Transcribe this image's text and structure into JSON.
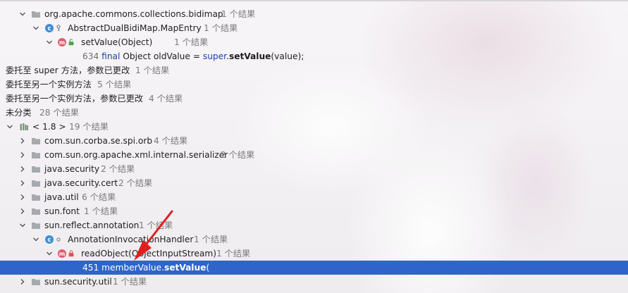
{
  "tree": {
    "pkg_bidimap": {
      "label": "org.apache.commons.collections.bidimap",
      "count": "1 个结果"
    },
    "class_mapentry": {
      "label": "AbstractDualBidiMap.MapEntry",
      "count": "1 个结果"
    },
    "method_setvalue": {
      "label": "setValue(Object)",
      "count": "1 个结果"
    },
    "code_634": {
      "line": "634",
      "kw_final": "final",
      "mid": " Object oldValue = ",
      "kw_super": "super",
      "dot": ".",
      "method": "setValue",
      "tail": "(value);"
    },
    "group_super": {
      "label": "委托至 super 方法，参数已更改",
      "count": "1 个结果"
    },
    "group_other": {
      "label": "委托至另一个实例方法",
      "count": "5 个结果"
    },
    "group_other_changed": {
      "label": "委托至另一个实例方法，参数已更改",
      "count": "4 个结果"
    },
    "group_unclassified": {
      "label": "未分类",
      "count": "28 个结果"
    },
    "lib_jdk": {
      "label": "< 1.8 >",
      "count": "19 个结果"
    },
    "pkgs": [
      {
        "label": "com.sun.corba.se.spi.orb",
        "count": "4 个结果"
      },
      {
        "label": "com.sun.org.apache.xml.internal.serializer",
        "count": "2 个结果"
      },
      {
        "label": "java.security",
        "count": "2 个结果"
      },
      {
        "label": "java.security.cert",
        "count": "2 个结果"
      },
      {
        "label": "java.util",
        "count": "6 个结果"
      },
      {
        "label": "sun.font",
        "count": "1 个结果"
      }
    ],
    "pkg_reflect": {
      "label": "sun.reflect.annotation",
      "count": "1 个结果"
    },
    "class_aih": {
      "label": "AnnotationInvocationHandler",
      "count": "1 个结果"
    },
    "method_readobject": {
      "label": "readObject(ObjectInputStream)",
      "count": "1 个结果"
    },
    "code_451": {
      "line": "451",
      "mid": " memberValue.",
      "method": "setValue",
      "tail": "("
    },
    "pkg_security_util": {
      "label": "sun.security.util",
      "count": "1 个结果"
    }
  },
  "colors": {
    "selection": "#2f65ca",
    "arrow": "#e01e1e",
    "keyword": "#1a3fa6",
    "count_text": "#7a7a7a"
  }
}
